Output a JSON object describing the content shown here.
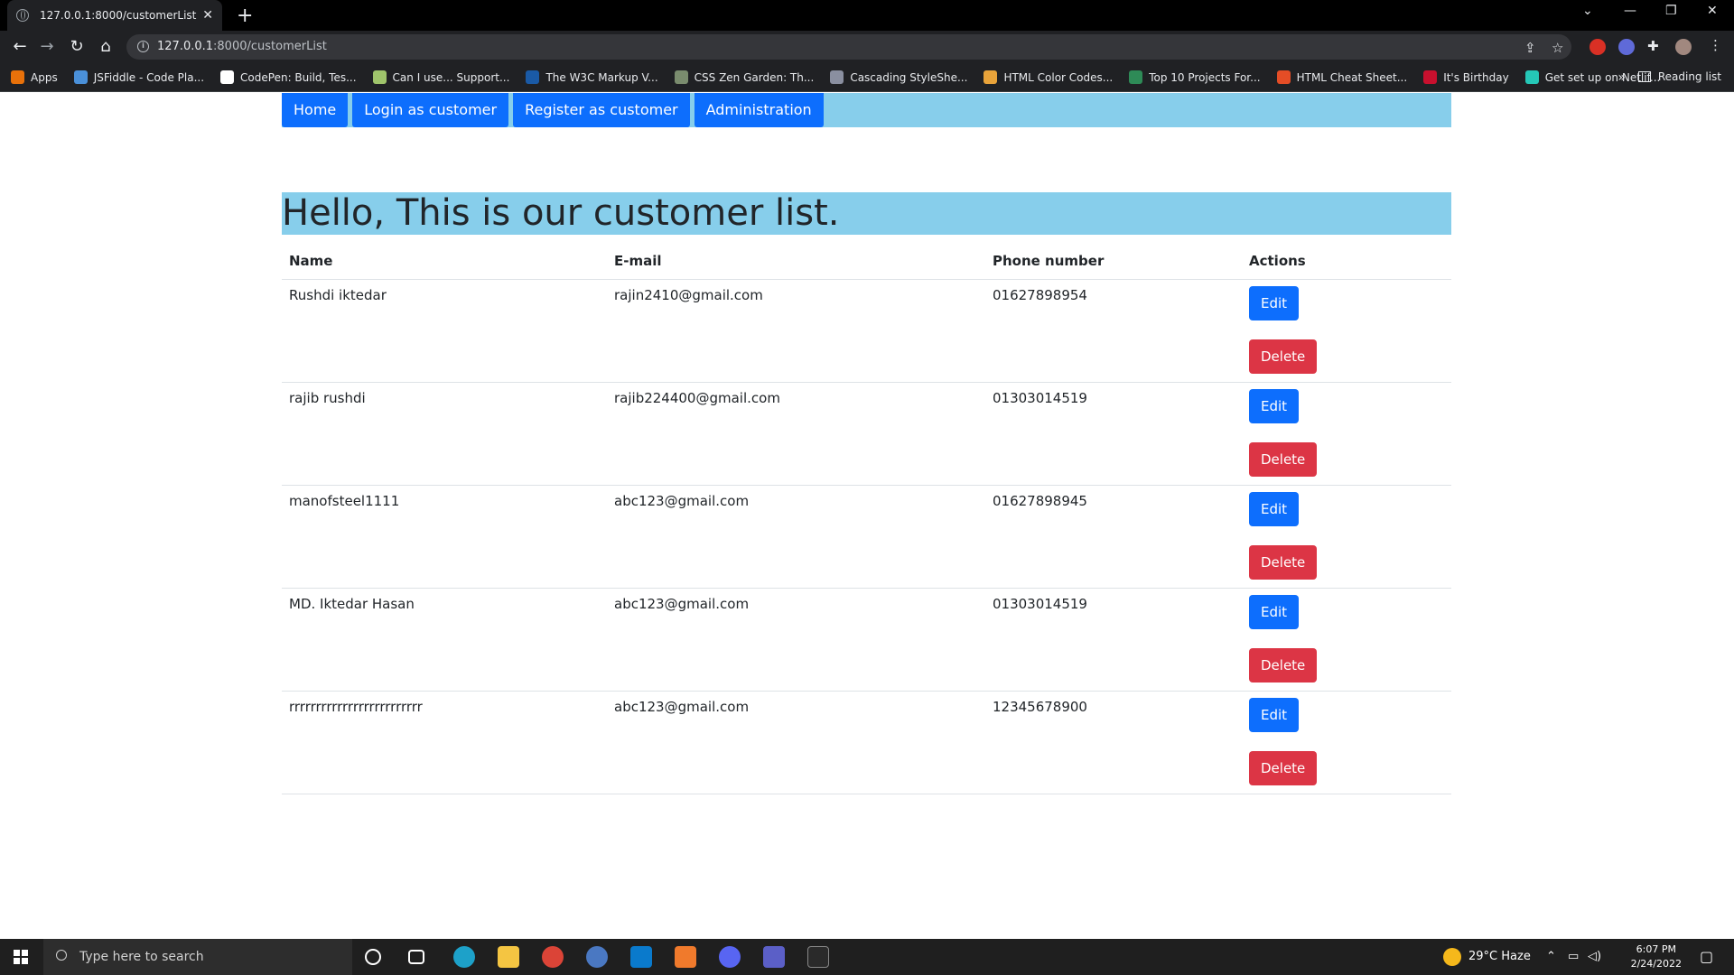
{
  "browser": {
    "tab_title": "127.0.0.1:8000/customerList",
    "url_host": "127.0.0.1",
    "url_rest": ":8000/customerList",
    "bookmarks": [
      {
        "label": "Apps",
        "color": "#e8710a"
      },
      {
        "label": "JSFiddle - Code Pla...",
        "color": "#4a90d9"
      },
      {
        "label": "CodePen: Build, Tes...",
        "color": "#ffffff"
      },
      {
        "label": "Can I use... Support...",
        "color": "#9fc46b"
      },
      {
        "label": "The W3C Markup V...",
        "color": "#1a5aa6"
      },
      {
        "label": "CSS Zen Garden: Th...",
        "color": "#7a8c6e"
      },
      {
        "label": "Cascading StyleShe...",
        "color": "#8a8fa0"
      },
      {
        "label": "HTML Color Codes...",
        "color": "#e8a33a"
      },
      {
        "label": "Top 10 Projects For...",
        "color": "#2e8b57"
      },
      {
        "label": "HTML Cheat Sheet...",
        "color": "#e44d26"
      },
      {
        "label": "It's Birthday",
        "color": "#c8102e"
      },
      {
        "label": "Get set up on Netlif...",
        "color": "#25c7b7"
      }
    ],
    "reading_list": "Reading list"
  },
  "nav": {
    "home": "Home",
    "login": "Login as customer",
    "register": "Register as customer",
    "admin": "Administration"
  },
  "heading": "Hello, This is our customer list.",
  "table": {
    "headers": [
      "Name",
      "E-mail",
      "Phone number",
      "Actions"
    ],
    "edit_label": "Edit",
    "delete_label": "Delete",
    "rows": [
      {
        "name": "Rushdi iktedar",
        "email": "rajin2410@gmail.com",
        "phone": "01627898954"
      },
      {
        "name": "rajib rushdi",
        "email": "rajib224400@gmail.com",
        "phone": "01303014519"
      },
      {
        "name": "manofsteel1111",
        "email": "abc123@gmail.com",
        "phone": "01627898945"
      },
      {
        "name": "MD. Iktedar Hasan",
        "email": "abc123@gmail.com",
        "phone": "01303014519"
      },
      {
        "name": "rrrrrrrrrrrrrrrrrrrrrrrrr",
        "email": "abc123@gmail.com",
        "phone": "12345678900"
      }
    ]
  },
  "taskbar": {
    "search_placeholder": "Type here to search",
    "weather": "29°C  Haze",
    "time": "6:07 PM",
    "date": "2/24/2022"
  },
  "colors": {
    "nav_bg": "#87ceeb",
    "primary": "#0d6efd",
    "danger": "#dc3545"
  }
}
